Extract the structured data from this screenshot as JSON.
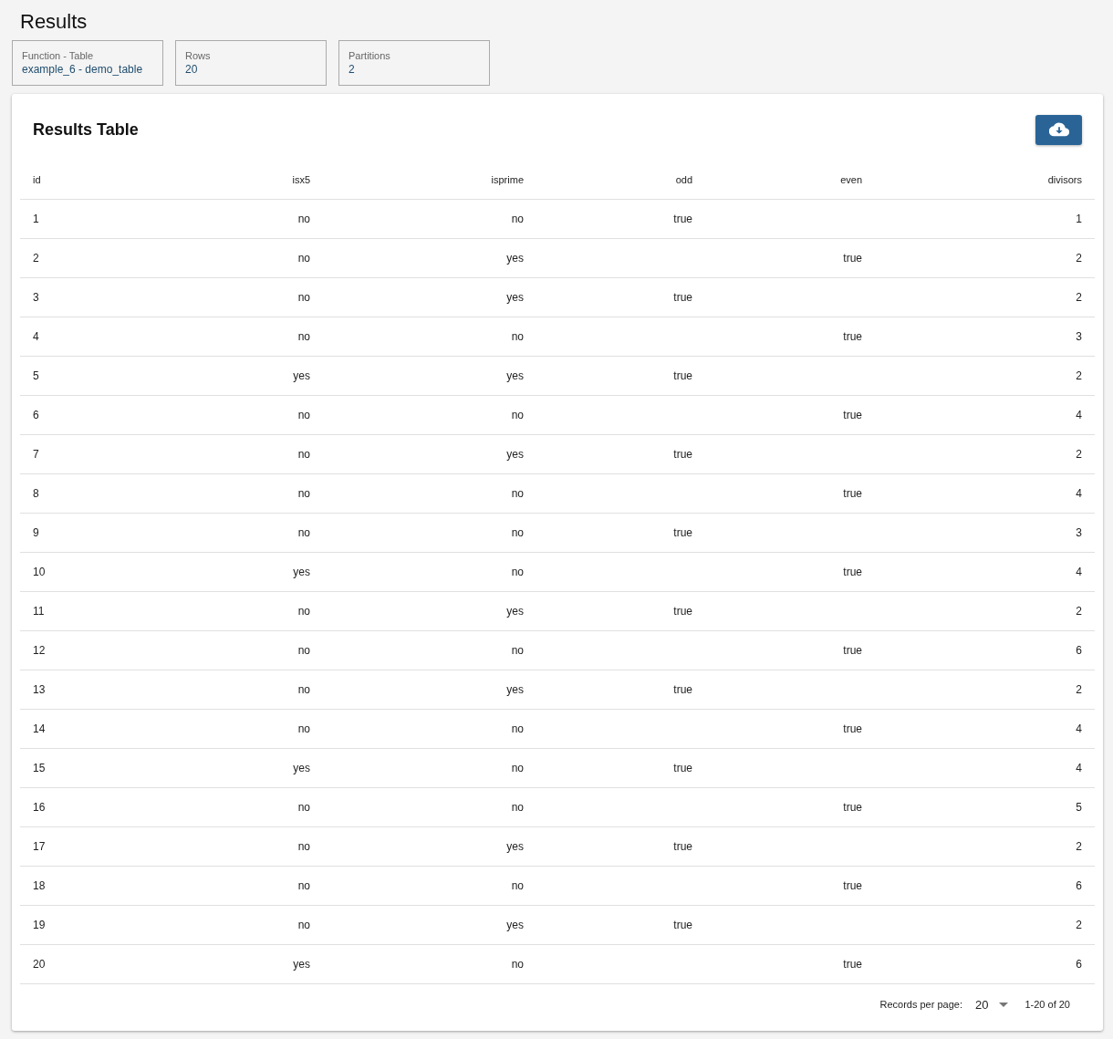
{
  "page_title": "Results",
  "info_cards": [
    {
      "label": "Function - Table",
      "value": "example_6 - demo_table"
    },
    {
      "label": "Rows",
      "value": "20"
    },
    {
      "label": "Partitions",
      "value": "2"
    }
  ],
  "results_table": {
    "title": "Results Table",
    "columns": [
      "id",
      "isx5",
      "isprime",
      "odd",
      "even",
      "divisors"
    ],
    "rows": [
      {
        "id": "1",
        "isx5": "no",
        "isprime": "no",
        "odd": "true",
        "divisors": "1"
      },
      {
        "id": "2",
        "isx5": "no",
        "isprime": "yes",
        "even": "true",
        "divisors": "2"
      },
      {
        "id": "3",
        "isx5": "no",
        "isprime": "yes",
        "odd": "true",
        "divisors": "2"
      },
      {
        "id": "4",
        "isx5": "no",
        "isprime": "no",
        "even": "true",
        "divisors": "3"
      },
      {
        "id": "5",
        "isx5": "yes",
        "isprime": "yes",
        "odd": "true",
        "divisors": "2"
      },
      {
        "id": "6",
        "isx5": "no",
        "isprime": "no",
        "even": "true",
        "divisors": "4"
      },
      {
        "id": "7",
        "isx5": "no",
        "isprime": "yes",
        "odd": "true",
        "divisors": "2"
      },
      {
        "id": "8",
        "isx5": "no",
        "isprime": "no",
        "even": "true",
        "divisors": "4"
      },
      {
        "id": "9",
        "isx5": "no",
        "isprime": "no",
        "odd": "true",
        "divisors": "3"
      },
      {
        "id": "10",
        "isx5": "yes",
        "isprime": "no",
        "even": "true",
        "divisors": "4"
      },
      {
        "id": "11",
        "isx5": "no",
        "isprime": "yes",
        "odd": "true",
        "divisors": "2"
      },
      {
        "id": "12",
        "isx5": "no",
        "isprime": "no",
        "even": "true",
        "divisors": "6"
      },
      {
        "id": "13",
        "isx5": "no",
        "isprime": "yes",
        "odd": "true",
        "divisors": "2"
      },
      {
        "id": "14",
        "isx5": "no",
        "isprime": "no",
        "even": "true",
        "divisors": "4"
      },
      {
        "id": "15",
        "isx5": "yes",
        "isprime": "no",
        "odd": "true",
        "divisors": "4"
      },
      {
        "id": "16",
        "isx5": "no",
        "isprime": "no",
        "even": "true",
        "divisors": "5"
      },
      {
        "id": "17",
        "isx5": "no",
        "isprime": "yes",
        "odd": "true",
        "divisors": "2"
      },
      {
        "id": "18",
        "isx5": "no",
        "isprime": "no",
        "even": "true",
        "divisors": "6"
      },
      {
        "id": "19",
        "isx5": "no",
        "isprime": "yes",
        "odd": "true",
        "divisors": "2"
      },
      {
        "id": "20",
        "isx5": "yes",
        "isprime": "no",
        "even": "true",
        "divisors": "6"
      }
    ],
    "pagination": {
      "records_per_page_label": "Records per page:",
      "records_per_page": "20",
      "range": "1-20 of 20"
    }
  }
}
